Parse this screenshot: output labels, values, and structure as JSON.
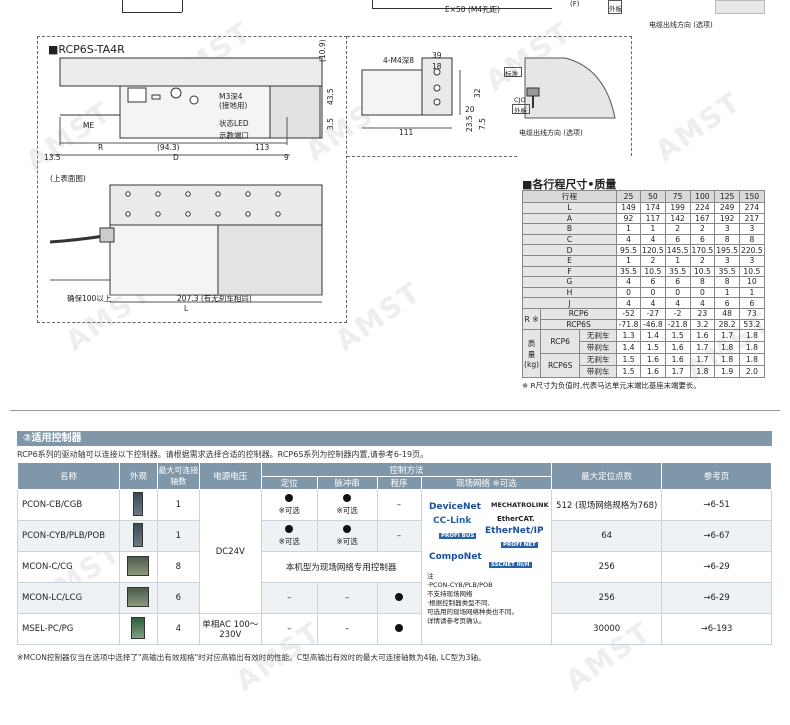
{
  "top_strip": {
    "dim_e50": "E×50 (M4孔距)",
    "cable_dir": "电缆出线方向 (选项)",
    "tag_outer": "外板"
  },
  "drawing": {
    "title": "■RCP6S-TA4R",
    "labels": {
      "m3_depth": "M3深4",
      "ground_terminal": "(接地用)",
      "status_led": "状态LED",
      "teaching_port": "示教端口",
      "me": "ME",
      "r": "R",
      "d": "D",
      "dim_943": "(94.3)",
      "dim_113": "113",
      "dim_135": "13.5",
      "dim_9": "9",
      "dim_109": "(10.9)",
      "dim_435": "43.5",
      "dim_35": "3.5",
      "four_m4": "4-M4深8",
      "dim_39": "39",
      "dim_18": "18",
      "dim_32": "32",
      "dim_235": "23.5",
      "dim_75": "7.5",
      "dim_111": "111",
      "dim_20": "20",
      "std": "标准",
      "cjo": "CJO",
      "outer": "外板",
      "cable_dir": "电缆出线方向 (选项)",
      "top_view": "(上表面图)",
      "min_bend": "确保100以上",
      "dim_2073": "207.3 (有无刹车相同)",
      "l": "L"
    }
  },
  "spec": {
    "title": "■各行程尺寸•质量",
    "stroke_label": "行程",
    "strokes": [
      "25",
      "50",
      "75",
      "100",
      "125",
      "150"
    ],
    "rows": [
      {
        "label": "L",
        "values": [
          "149",
          "174",
          "199",
          "224",
          "249",
          "274"
        ]
      },
      {
        "label": "A",
        "values": [
          "92",
          "117",
          "142",
          "167",
          "192",
          "217"
        ]
      },
      {
        "label": "B",
        "values": [
          "1",
          "1",
          "2",
          "2",
          "3",
          "3"
        ]
      },
      {
        "label": "C",
        "values": [
          "4",
          "4",
          "6",
          "6",
          "8",
          "8"
        ]
      },
      {
        "label": "D",
        "values": [
          "95.5",
          "120.5",
          "145.5",
          "170.5",
          "195.5",
          "220.5"
        ]
      },
      {
        "label": "E",
        "values": [
          "1",
          "2",
          "1",
          "2",
          "3",
          "3"
        ]
      },
      {
        "label": "F",
        "values": [
          "35.5",
          "10.5",
          "35.5",
          "10.5",
          "35.5",
          "10.5"
        ]
      },
      {
        "label": "G",
        "values": [
          "4",
          "6",
          "6",
          "8",
          "8",
          "10"
        ]
      },
      {
        "label": "H",
        "values": [
          "0",
          "0",
          "0",
          "0",
          "1",
          "1"
        ]
      },
      {
        "label": "J",
        "values": [
          "4",
          "4",
          "4",
          "4",
          "6",
          "6"
        ]
      }
    ],
    "r_label": "R ※",
    "r_rows": [
      {
        "label": "RCP6",
        "values": [
          "-52",
          "-27",
          "-2",
          "23",
          "48",
          "73"
        ]
      },
      {
        "label": "RCP6S",
        "values": [
          "-71.8",
          "-46.8",
          "-21.8",
          "3.2",
          "28.2",
          "53.2"
        ]
      }
    ],
    "mass_label": "质量 (kg)",
    "mass_groups": [
      {
        "group": "RCP6",
        "rows": [
          {
            "label": "无刹车",
            "values": [
              "1.3",
              "1.4",
              "1.5",
              "1.6",
              "1.7",
              "1.8"
            ]
          },
          {
            "label": "带刹车",
            "values": [
              "1.4",
              "1.5",
              "1.6",
              "1.7",
              "1.8",
              "1.8"
            ]
          }
        ]
      },
      {
        "group": "RCP6S",
        "rows": [
          {
            "label": "无刹车",
            "values": [
              "1.5",
              "1.6",
              "1.6",
              "1.7",
              "1.8",
              "1.8"
            ]
          },
          {
            "label": "带刹车",
            "values": [
              "1.5",
              "1.6",
              "1.7",
              "1.8",
              "1.9",
              "2.0"
            ]
          }
        ]
      }
    ],
    "note": "※ R尺寸为负值时,代表马达单元末端比基座末端要长。"
  },
  "controllers": {
    "header": "②适用控制器",
    "intro": "RCP6系列的驱动轴可以连接以下控制器。请根据需求选择合适的控制器。RCP6S系列为控制器内置,请参考6-19页。",
    "col_name": "名称",
    "col_appearance": "外观",
    "col_max_axes": "最大可连接轴数",
    "col_power": "电源电压",
    "col_control": "控制方法",
    "col_position": "定位",
    "col_pulse": "脉冲串",
    "col_program": "程序",
    "col_network": "现场网络 ※可选",
    "col_max_points": "最大定位点数",
    "col_ref": "参考页",
    "opt": "※可选",
    "dash": "–",
    "power_dc": "DC24V",
    "power_ac": "单相AC 100～230V",
    "network_only": "本机型为现场网络专用控制器",
    "rows": [
      {
        "name": "PCON-CB/CGB",
        "axes": "1",
        "points": "512 (现场网络规格为768)",
        "ref": "→6-51"
      },
      {
        "name": "PCON-CYB/PLB/POB",
        "axes": "1",
        "points": "64",
        "ref": "→6-67"
      },
      {
        "name": "MCON-C/CG",
        "axes": "8",
        "points": "256",
        "ref": "→6-29"
      },
      {
        "name": "MCON-LC/LCG",
        "axes": "6",
        "points": "256",
        "ref": "→6-29"
      },
      {
        "name": "MSEL-PC/PG",
        "axes": "4",
        "points": "30000",
        "ref": "→6-193"
      }
    ],
    "logos": [
      "DeviceNet",
      "MECHATROLINK",
      "CC-Link",
      "EtherCAT.",
      "PROFI BUS",
      "EtherNet/IP",
      "CompoNet",
      "PROFI NET",
      "SSCNET III/H"
    ],
    "net_note_title": "注",
    "net_note_1": "·PCON-CYB/PLB/POB",
    "net_note_2": "不支持现场网络",
    "net_note_3": "·根据控制器类型不同,",
    "net_note_4": "可选用的现场网络种类也不同。",
    "net_note_5": "详情请参考页确认。",
    "footnote": "※MCON控制器仅当在选项中选择了\"高输出有效规格\"时对应高输出有效时的性能。C型高输出有效时的最大可连接轴数为4轴, LC型为3轴。"
  },
  "watermark": "AMST"
}
